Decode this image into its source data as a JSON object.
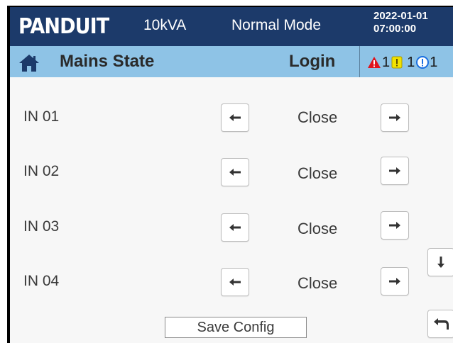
{
  "header": {
    "brand": "PANDUIT",
    "capacity": "10kVA",
    "mode": "Normal Mode",
    "date": "2022-01-01",
    "time": "07:00:00"
  },
  "subheader": {
    "title": "Mains State",
    "login_label": "Login",
    "alarms": {
      "critical_count": "1",
      "warning_count": "1",
      "info_count": "1"
    }
  },
  "inputs": [
    {
      "label": "IN 01",
      "state": "Close"
    },
    {
      "label": "IN 02",
      "state": "Close"
    },
    {
      "label": "IN 03",
      "state": "Close"
    },
    {
      "label": "IN 04",
      "state": "Close"
    }
  ],
  "save_label": "Save Config",
  "colors": {
    "header_bg": "#1c3a6a",
    "subheader_bg": "#8ec3e6",
    "critical": "#e0141e",
    "warning": "#f2e200",
    "info": "#1a6fe0"
  },
  "icons": {
    "home": "home-icon",
    "left": "arrow-left-icon",
    "right": "arrow-right-icon",
    "down": "arrow-down-icon",
    "back": "back-return-icon"
  }
}
